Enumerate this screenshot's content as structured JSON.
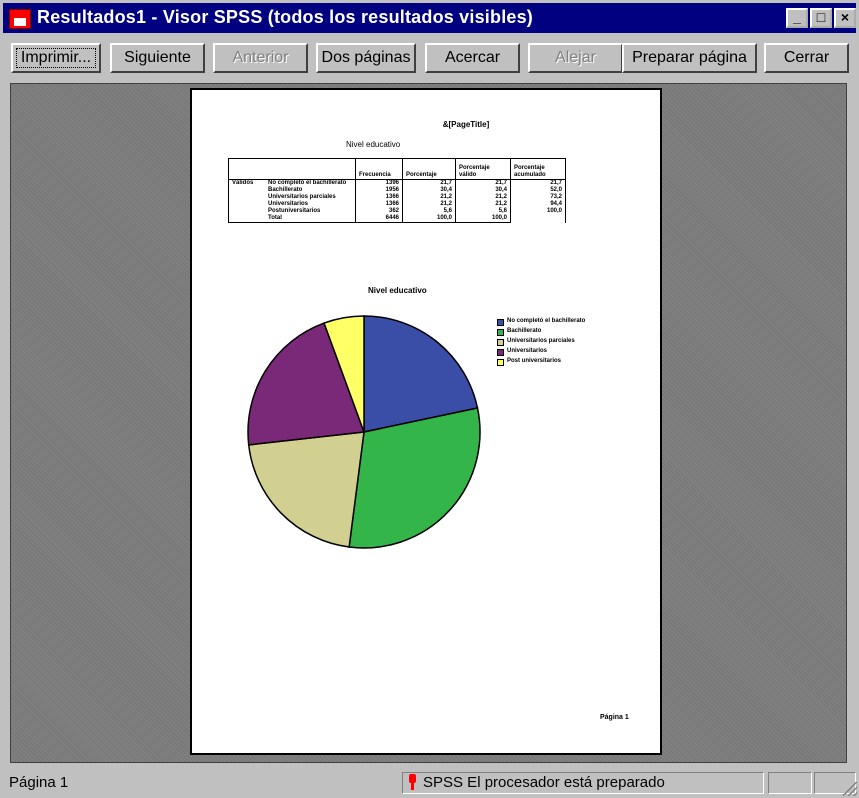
{
  "window": {
    "title": "Resultados1 - Visor SPSS (todos los resultados visibles)"
  },
  "titlebar_buttons": {
    "minimize": "_",
    "maximize": "□",
    "close": "×"
  },
  "toolbar": {
    "print": "Imprimir...",
    "next": "Siguiente",
    "previous": "Anterior",
    "two_pages": "Dos páginas",
    "zoom_in": "Acercar",
    "zoom_out": "Alejar",
    "page_setup": "Preparar página",
    "close": "Cerrar"
  },
  "page": {
    "title": "&[PageTitle]",
    "table_title": "Nivel educativo",
    "headers": [
      "",
      "",
      "Frecuencia",
      "Porcentaje",
      "Porcentaje válido",
      "Porcentaje acumulado"
    ],
    "row_label": "Válidos",
    "rows": [
      [
        "No completó el bachillerato",
        "1396",
        "21,7",
        "21,7",
        "21,7"
      ],
      [
        "Bachillerato",
        "1956",
        "30,4",
        "30,4",
        "52,0"
      ],
      [
        "Universitarios parciales",
        "1366",
        "21,2",
        "21,2",
        "73,2"
      ],
      [
        "Universitarios",
        "1366",
        "21,2",
        "21,2",
        "94,4"
      ],
      [
        "Postuniversitarios",
        "362",
        "5,6",
        "5,6",
        "100,0"
      ],
      [
        "Total",
        "6446",
        "100,0",
        "100,0",
        ""
      ]
    ],
    "footer": "Página 1"
  },
  "chart_data": {
    "type": "pie",
    "title": "Nivel educativo",
    "categories": [
      "No completó el bachillerato",
      "Bachillerato",
      "Universitarios parciales",
      "Universitarios",
      "Post universitarios"
    ],
    "values": [
      21.7,
      30.4,
      21.2,
      21.2,
      5.6
    ],
    "colors": [
      "#3a4ea8",
      "#33b54a",
      "#d2d090",
      "#7a2878",
      "#ffff66"
    ],
    "legend_position": "right"
  },
  "status": {
    "page": "Página 1",
    "processor": "SPSS El procesador  está preparado"
  }
}
